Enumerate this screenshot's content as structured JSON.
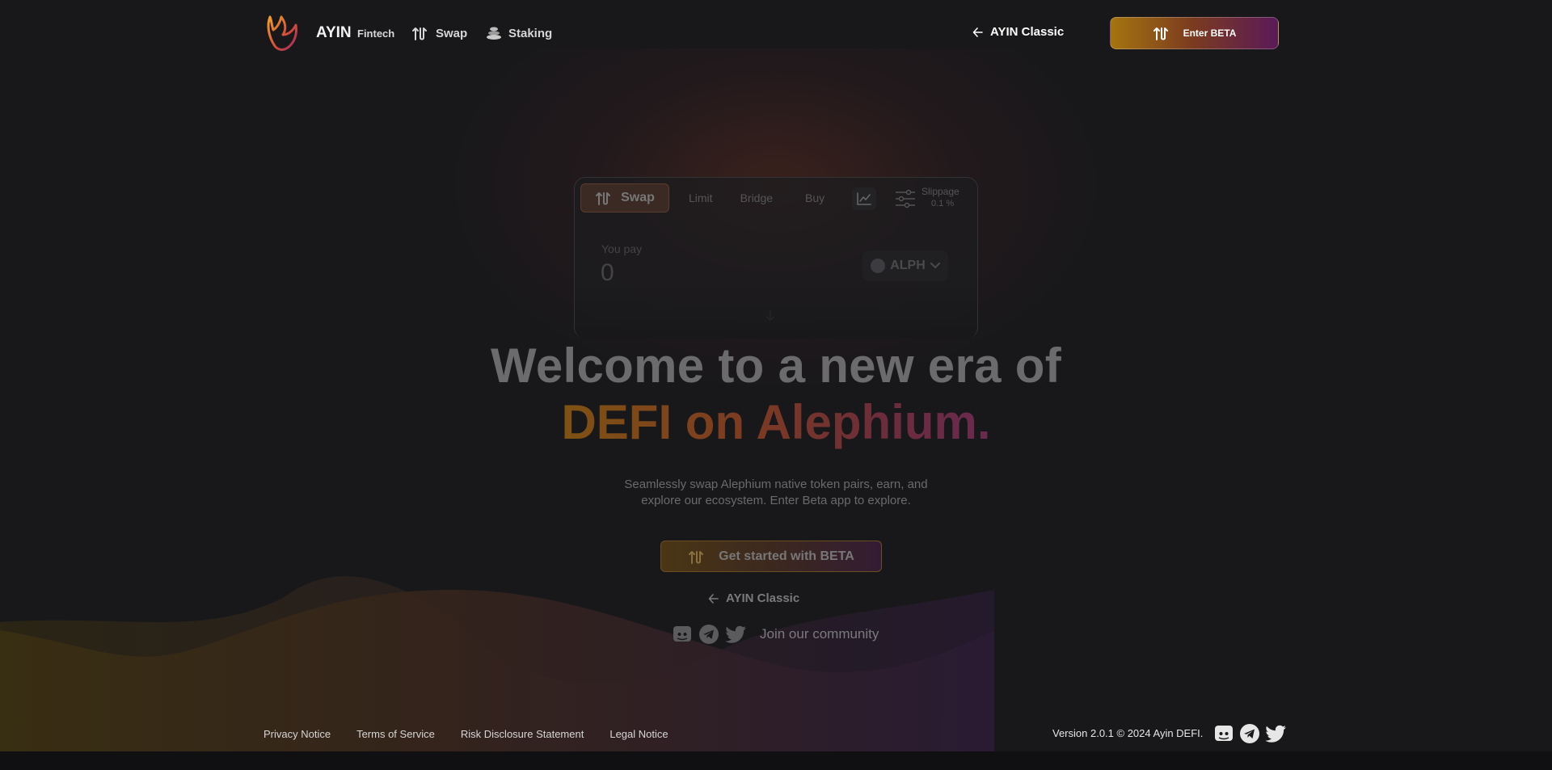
{
  "header": {
    "brand": "AYIN",
    "brand_sub": "Fintech",
    "nav": {
      "swap": "Swap",
      "staking": "Staking"
    },
    "classic_link": "AYIN Classic",
    "enter_beta": "Enter BETA"
  },
  "card": {
    "tabs": {
      "swap": "Swap",
      "limit": "Limit",
      "bridge": "Bridge",
      "buy": "Buy"
    },
    "slippage_label": "Slippage",
    "slippage_value": "0.1 %",
    "pay_label": "You pay",
    "pay_value": "0",
    "token": "ALPH"
  },
  "hero": {
    "line1": "Welcome to a new era of",
    "line2": "DEFI on Alephium.",
    "subtitle": "Seamlessly swap Alephium native token pairs, earn, and explore our ecosystem. Enter Beta app to explore.",
    "cta": "Get started with BETA",
    "classic_link": "AYIN Classic",
    "community": "Join our community"
  },
  "footer": {
    "links": [
      "Privacy Notice",
      "Terms of Service",
      "Risk Disclosure Statement",
      "Legal Notice"
    ],
    "version": "Version 2.0.1 © 2024 Ayin DEFI."
  },
  "icons": [
    "discord-icon",
    "telegram-icon",
    "twitter-icon",
    "swap-icon",
    "staking-icon",
    "arrow-left-icon",
    "chart-icon",
    "settings-sliders-icon",
    "chevron-down-icon",
    "arrow-down-icon"
  ],
  "colors": {
    "background": "#18181b",
    "accent_gold": "#a5740f",
    "accent_purple": "#5a1a58"
  }
}
